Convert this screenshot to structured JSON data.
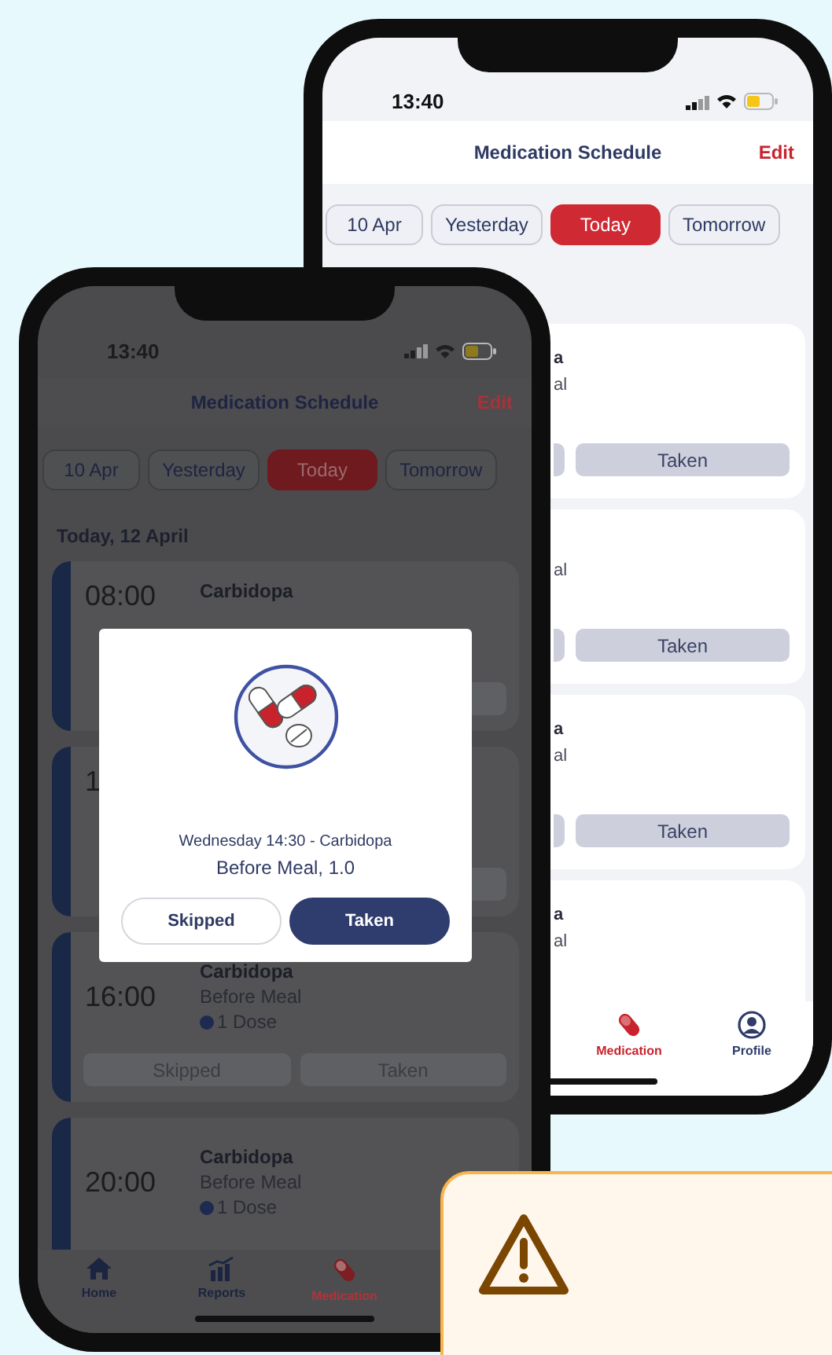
{
  "back_phone": {
    "status_time": "13:40",
    "header": {
      "title": "Medication Schedule",
      "action": "Edit"
    },
    "date_chips": [
      {
        "label": "10 Apr",
        "selected": false
      },
      {
        "label": "Yesterday",
        "selected": false
      },
      {
        "label": "Today",
        "selected": true
      },
      {
        "label": "Tomorrow",
        "selected": false
      }
    ],
    "cards": [
      {
        "name": "a",
        "meal": "al",
        "taken": "Taken"
      },
      {
        "meal": "al",
        "taken": "Taken"
      },
      {
        "name": "a",
        "meal": "al",
        "taken": "Taken"
      },
      {
        "name": "a",
        "meal": "al"
      }
    ],
    "tab_bar": [
      {
        "label": "Medication",
        "kind": "pill",
        "selected": true
      },
      {
        "label": "Profile",
        "kind": "profile",
        "selected": false
      }
    ]
  },
  "front_phone": {
    "status_time": "13:40",
    "header": {
      "title": "Medication Schedule",
      "action": "Edit"
    },
    "date_chips": [
      {
        "label": "10 Apr",
        "selected": false
      },
      {
        "label": "Yesterday",
        "selected": false
      },
      {
        "label": "Today",
        "selected": true
      },
      {
        "label": "Tomorrow",
        "selected": false
      }
    ],
    "date_heading": "Today, 12 April",
    "cards": [
      {
        "kind": "covered",
        "time": "08:00",
        "name": "Carbidopa"
      },
      {
        "kind": "covered",
        "time": "1"
      },
      {
        "kind": "full",
        "time": "16:00",
        "name": "Carbidopa",
        "meal": "Before Meal",
        "dose": "1 Dose",
        "buttons": [
          "Skipped",
          "Taken"
        ]
      },
      {
        "kind": "full",
        "time": "20:00",
        "name": "Carbidopa",
        "meal": "Before Meal",
        "dose": "1 Dose"
      }
    ],
    "tab_bar": [
      {
        "label": "Home",
        "kind": "home",
        "selected": false
      },
      {
        "label": "Reports",
        "kind": "reports",
        "selected": false
      },
      {
        "label": "Medication",
        "kind": "pill",
        "selected": true
      }
    ],
    "dialog": {
      "message": "Wednesday 14:30 - Carbidopa",
      "detail": "Before Meal, 1.0",
      "buttons": [
        {
          "label": "Skipped",
          "kind": "secondary"
        },
        {
          "label": "Taken",
          "kind": "primary"
        }
      ]
    }
  },
  "notice": {
    "kind": "warning"
  }
}
